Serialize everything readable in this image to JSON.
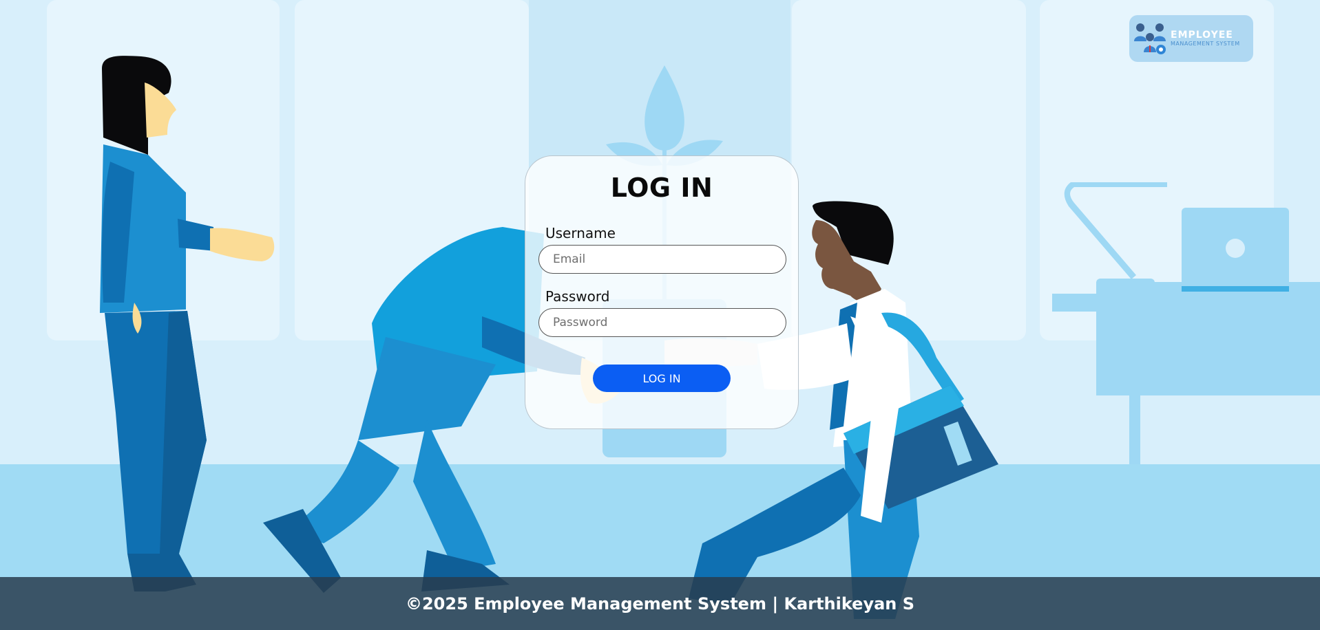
{
  "logo": {
    "title": "EMPLOYEE",
    "subtitle": "MANAGEMENT SYSTEM",
    "icon": "people-gear-icon"
  },
  "login": {
    "title": "LOG IN",
    "username_label": "Username",
    "username_placeholder": "Email",
    "password_label": "Password",
    "password_placeholder": "Password",
    "button_label": "LOG IN"
  },
  "footer": {
    "text": "©2025 Employee Management System | Karthikeyan S"
  },
  "colors": {
    "background": "#d6eefb",
    "accent_button": "#0b5ef3",
    "figure_blue": "#1a8ed0",
    "footer_bar": "#283c4e"
  }
}
